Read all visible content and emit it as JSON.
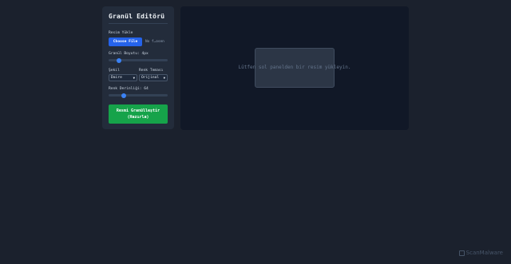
{
  "panel": {
    "title": "Granül Editörü",
    "upload_label": "Resim Yükle",
    "file_button": "Choose File",
    "file_name": "No f…osen",
    "grain_size_label": "Granül Boyutu: 4px",
    "grain_size_value": 0.18,
    "shape_label": "Şekil",
    "shape_value": "Daire",
    "color_theme_label": "Renk Teması",
    "color_theme_value": "Orijinal",
    "color_depth_label": "Renk Derinliği: 64",
    "color_depth_value": 0.26,
    "submit_label_line1": "Resmi Granülleştir",
    "submit_label_line2": "(Hazırla)"
  },
  "canvas": {
    "placeholder_text": "Lütfen sol panelden bir resim yükleyin."
  },
  "watermark": {
    "text": "ScanMalware",
    "icon": "scan-icon"
  },
  "colors": {
    "background": "#1b212d",
    "panel": "#232c3b",
    "primary": "#2563eb",
    "success": "#16a34a",
    "slider_thumb": "#3b82f6"
  }
}
